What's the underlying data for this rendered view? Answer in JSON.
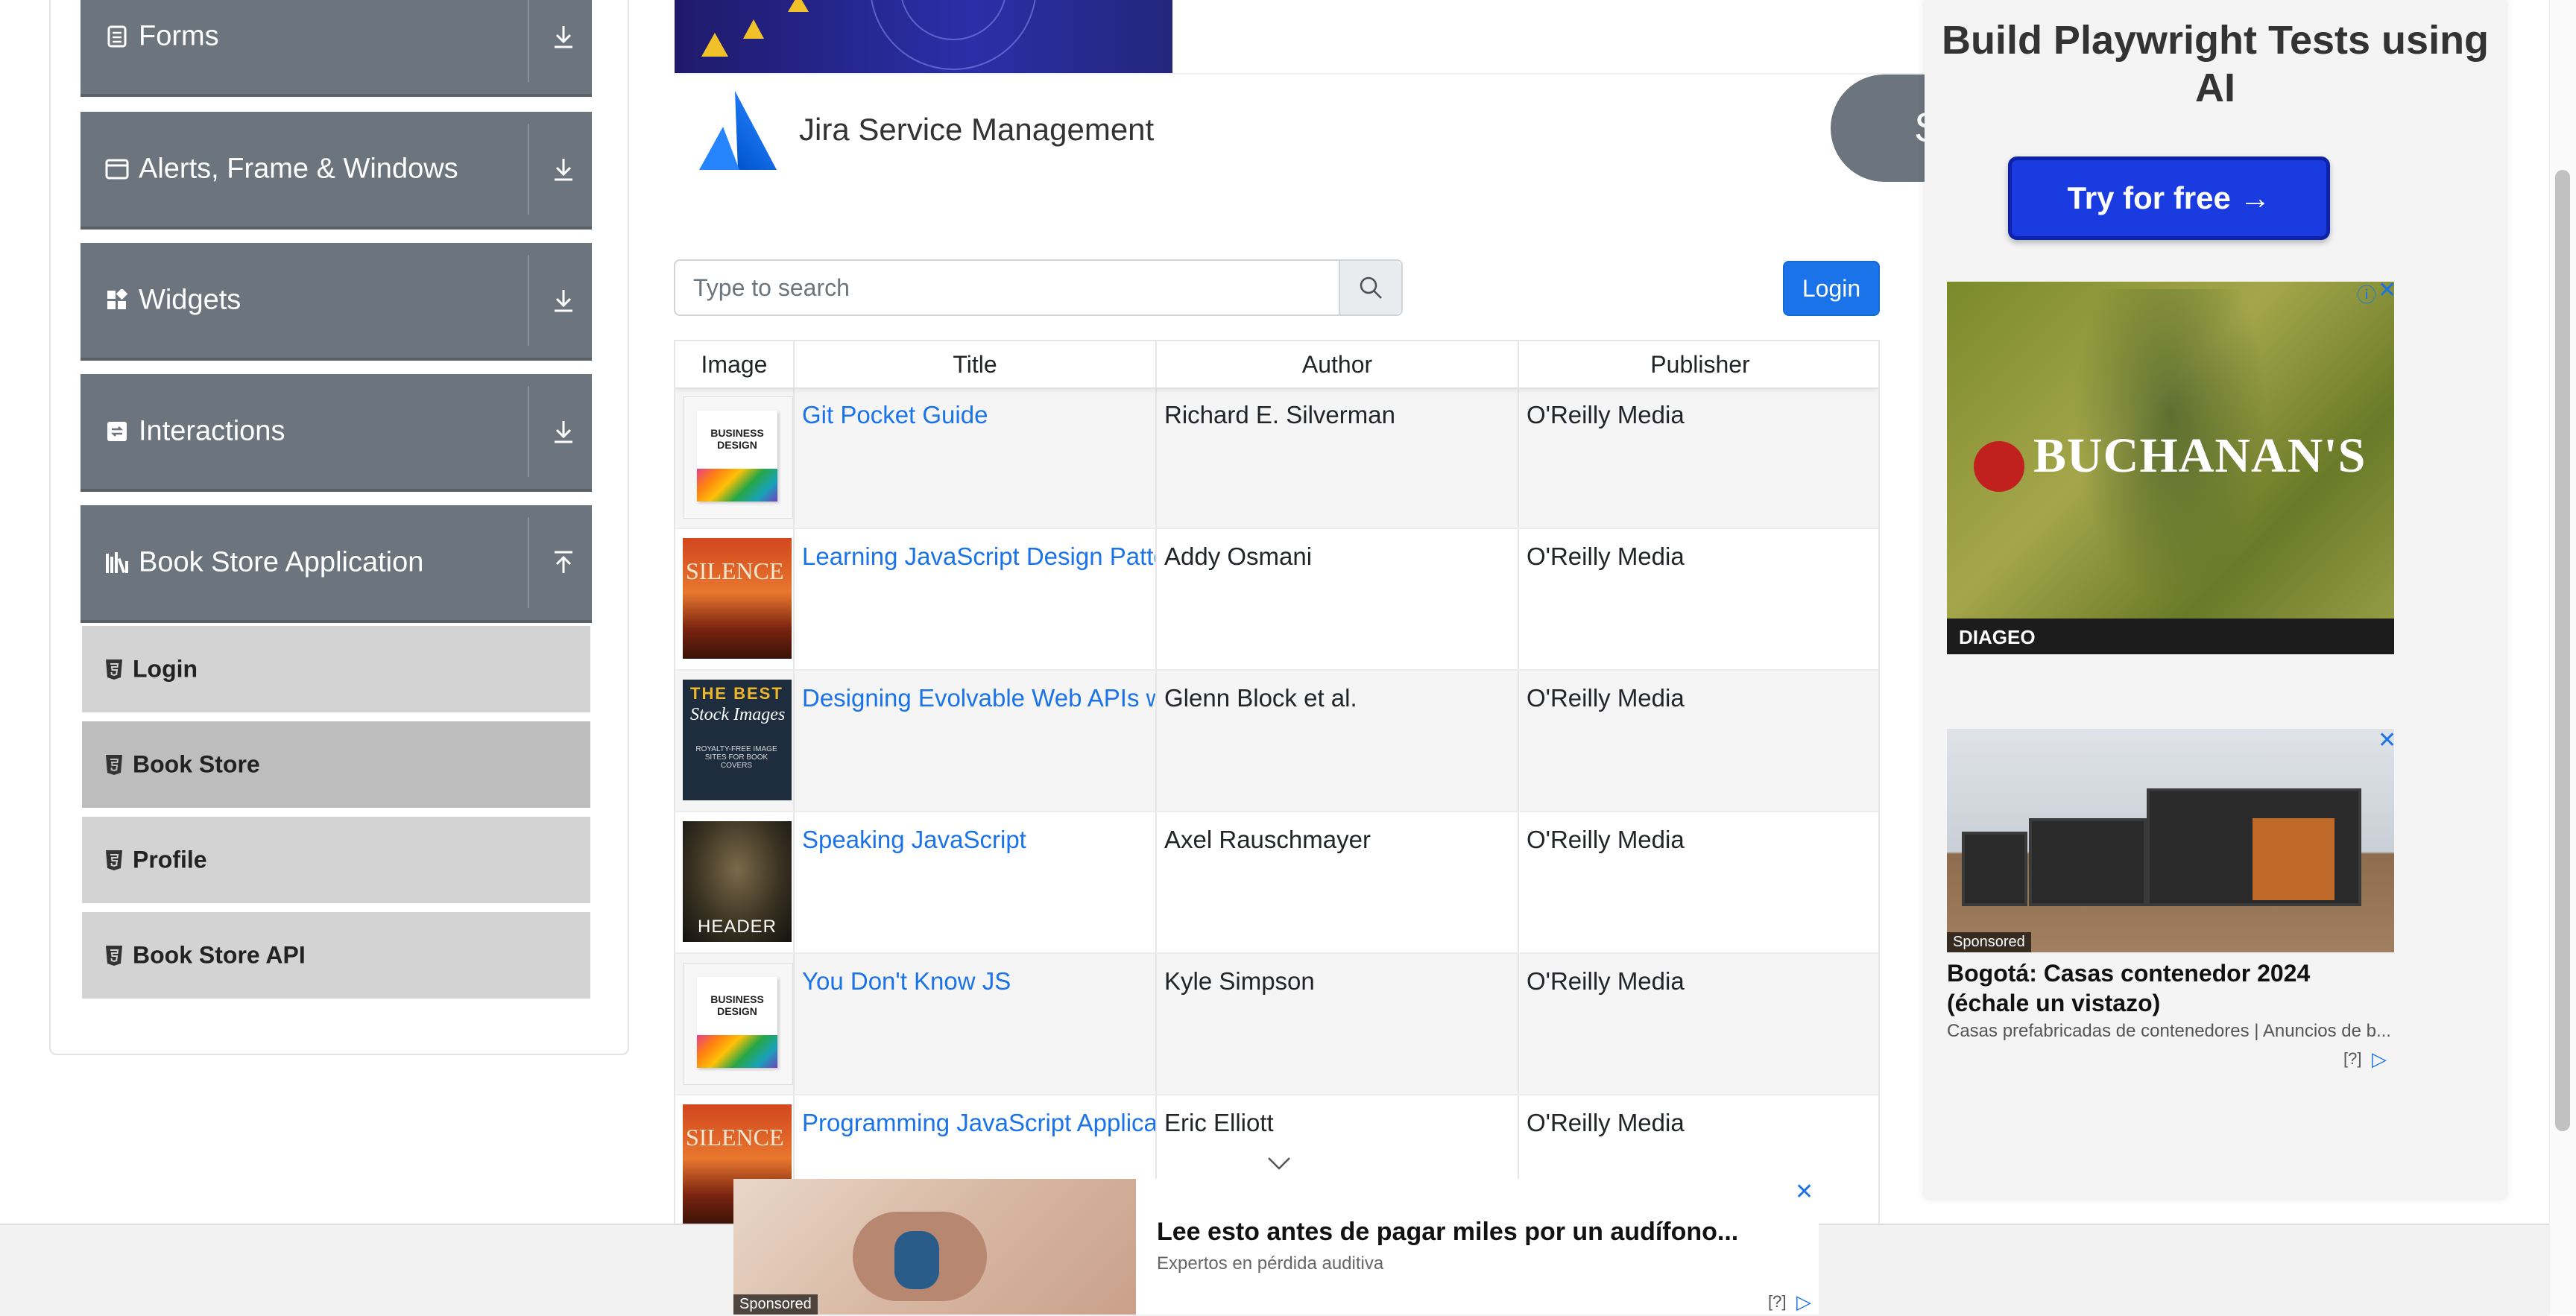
{
  "sidebar": {
    "groups": [
      {
        "label": "Forms",
        "icon": "forms-icon"
      },
      {
        "label": "Alerts, Frame & Windows",
        "icon": "window-icon"
      },
      {
        "label": "Widgets",
        "icon": "widgets-icon"
      },
      {
        "label": "Interactions",
        "icon": "interactions-icon"
      },
      {
        "label": "Book Store Application",
        "icon": "books-icon"
      }
    ],
    "items": [
      {
        "label": "Login"
      },
      {
        "label": "Book Store",
        "active": true
      },
      {
        "label": "Profile"
      },
      {
        "label": "Book Store API"
      }
    ]
  },
  "header": {
    "brand": "Jira Service Management",
    "pill_letter": "S"
  },
  "search": {
    "placeholder": "Type to search",
    "value": ""
  },
  "login_button": "Login",
  "table": {
    "columns": [
      "Image",
      "Title",
      "Author",
      "Publisher"
    ],
    "rows": [
      {
        "title": "Git Pocket Guide",
        "author": "Richard E. Silverman",
        "publisher": "O'Reilly Media",
        "cover": "business-design"
      },
      {
        "title": "Learning JavaScript Design Patte",
        "author": "Addy Osmani",
        "publisher": "O'Reilly Media",
        "cover": "silence"
      },
      {
        "title": "Designing Evolvable Web APIs wi",
        "author": "Glenn Block et al.",
        "publisher": "O'Reilly Media",
        "cover": "stock-images"
      },
      {
        "title": "Speaking JavaScript",
        "author": "Axel Rauschmayer",
        "publisher": "O'Reilly Media",
        "cover": "header"
      },
      {
        "title": "You Don't Know JS",
        "author": "Kyle Simpson",
        "publisher": "O'Reilly Media",
        "cover": "business-design"
      },
      {
        "title": "Programming JavaScript Applica",
        "author": "Eric Elliott",
        "publisher": "O'Reilly Media",
        "cover": "silence"
      }
    ]
  },
  "cover_texts": {
    "business_design": "BUSINESS DESIGN",
    "silence": "SILENCE",
    "stock_top": "THE BEST",
    "stock_mid": "Stock Images",
    "stock_bottom": "ROYALTY-FREE IMAGE SITES FOR BOOK COVERS",
    "header": "HEADER"
  },
  "ads": {
    "playwright": {
      "title": "Build Playwright Tests using AI",
      "button": "Try for free →"
    },
    "buchanans": {
      "brand": "BUCHANAN'S",
      "footer_brand": "DIAGEO"
    },
    "house": {
      "sponsored": "Sponsored",
      "title": "Bogotá: Casas contenedor 2024 (échale un vistazo)",
      "subtitle": "Casas prefabricadas de contenedores | Anuncios de b...",
      "info": "[?]"
    },
    "bottom": {
      "sponsored": "Sponsored",
      "title": "Lee esto antes de pagar miles por un audífono...",
      "subtitle": "Expertos en pérdida auditiva",
      "info": "[?]"
    }
  },
  "colors": {
    "sidebar_group": "#6c757d",
    "sidebar_item": "#d3d3d3",
    "sidebar_item_active": "#bdbdbd",
    "link": "#1a73e8",
    "login_button": "#1a73e8"
  }
}
